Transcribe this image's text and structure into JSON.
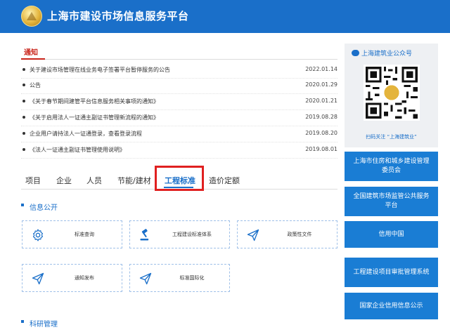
{
  "header": {
    "title": "上海市建设市场信息服务平台"
  },
  "notice": {
    "heading": "通知",
    "items": [
      {
        "text": "关于建设市场管理在线业务电子签署平台暂停服务的公告",
        "date": "2022.01.14"
      },
      {
        "text": "公告",
        "date": "2020.01.29"
      },
      {
        "text": "《关于春节期间建管平台信息服务相关事项的通知》",
        "date": "2020.01.21"
      },
      {
        "text": "《关于启用法人一证通主副证书管理新流程的通知》",
        "date": "2019.08.28"
      },
      {
        "text": "企业用户请持法人一证通登录，查看登录流程",
        "date": "2019.08.20"
      },
      {
        "text": "《法人一证通主副证书管理使用说明》",
        "date": "2019.08.01"
      }
    ]
  },
  "tabs": [
    "项目",
    "企业",
    "人员",
    "节能/建材",
    "工程标准",
    "造价定额"
  ],
  "sections": {
    "info_public": {
      "title": "信息公开",
      "cards": [
        {
          "label": "标准查询",
          "icon": "gear-icon"
        },
        {
          "label": "工程建设标准体系",
          "icon": "gavel-icon"
        },
        {
          "label": "政策性文件",
          "icon": "send-icon"
        },
        {
          "label": "通知发布",
          "icon": "send-icon"
        },
        {
          "label": "标准国际化",
          "icon": "send-icon"
        }
      ]
    },
    "research": {
      "title": "科研管理"
    }
  },
  "sidebar": {
    "wechat_title": "上海建筑业公众号",
    "qr_caption": "扫码关注 “上海建筑业”",
    "buttons": [
      "上海市住房和城乡建设管理委员会",
      "全国建筑市场监管公共服务平台",
      "信用中国",
      "工程建设项目审批管理系统",
      "国家企业信用信息公示"
    ]
  },
  "colors": {
    "primary": "#1a6fc9",
    "highlight": "#e02020",
    "notice_accent": "#c9241a"
  }
}
